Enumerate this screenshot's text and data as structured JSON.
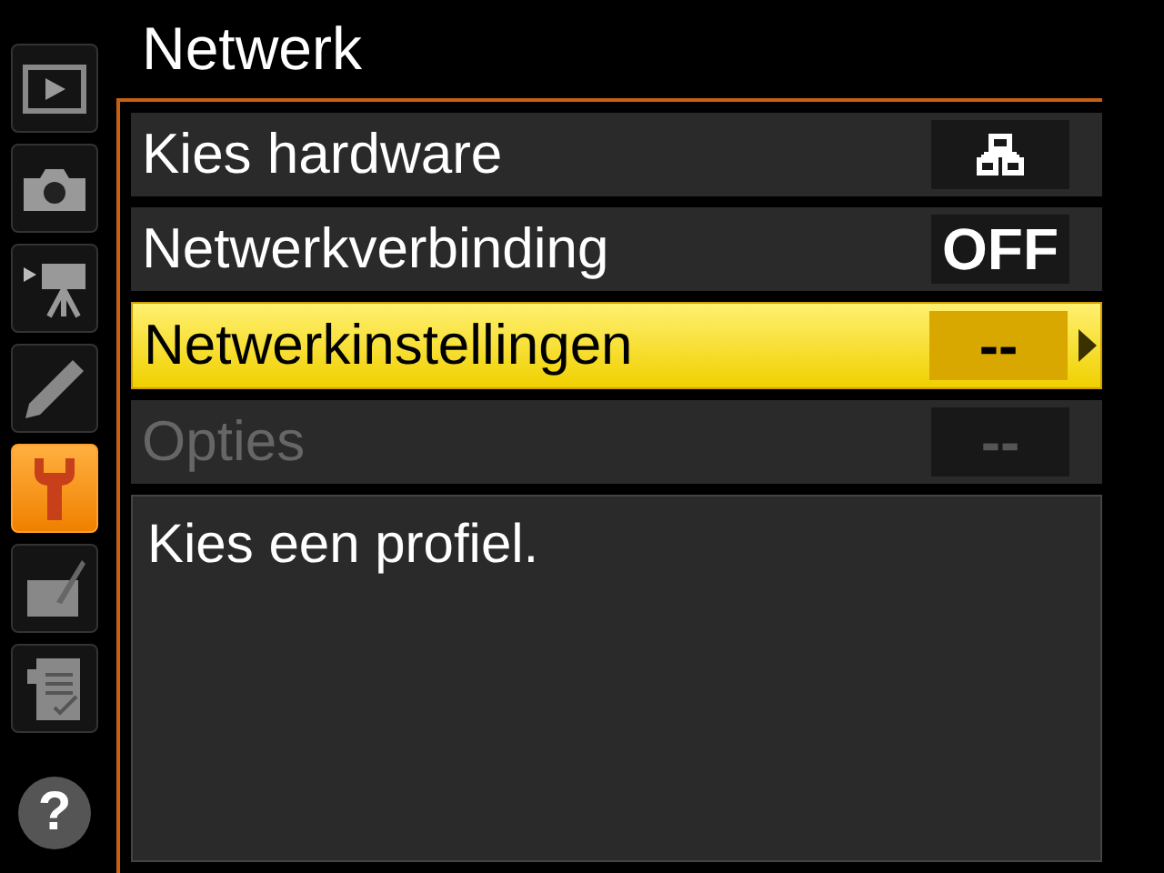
{
  "sidebar": {
    "tabs": [
      {
        "kind": "playback",
        "selected": false
      },
      {
        "kind": "camera",
        "selected": false
      },
      {
        "kind": "movie",
        "selected": false
      },
      {
        "kind": "pencil",
        "selected": false
      },
      {
        "kind": "wrench",
        "selected": true
      },
      {
        "kind": "retouch",
        "selected": false
      },
      {
        "kind": "recent",
        "selected": false
      }
    ],
    "help": "?"
  },
  "title": "Netwerk",
  "items": [
    {
      "label": "Kies hardware",
      "kind": "icon",
      "selected": false,
      "disabled": false
    },
    {
      "label": "Netwerkverbinding",
      "value": "OFF",
      "kind": "text",
      "selected": false,
      "disabled": false
    },
    {
      "label": "Netwerkinstellingen",
      "value": "--",
      "kind": "text",
      "selected": true,
      "disabled": false
    },
    {
      "label": "Opties",
      "value": "--",
      "kind": "text",
      "selected": false,
      "disabled": true
    }
  ],
  "description": "Kies een profiel."
}
